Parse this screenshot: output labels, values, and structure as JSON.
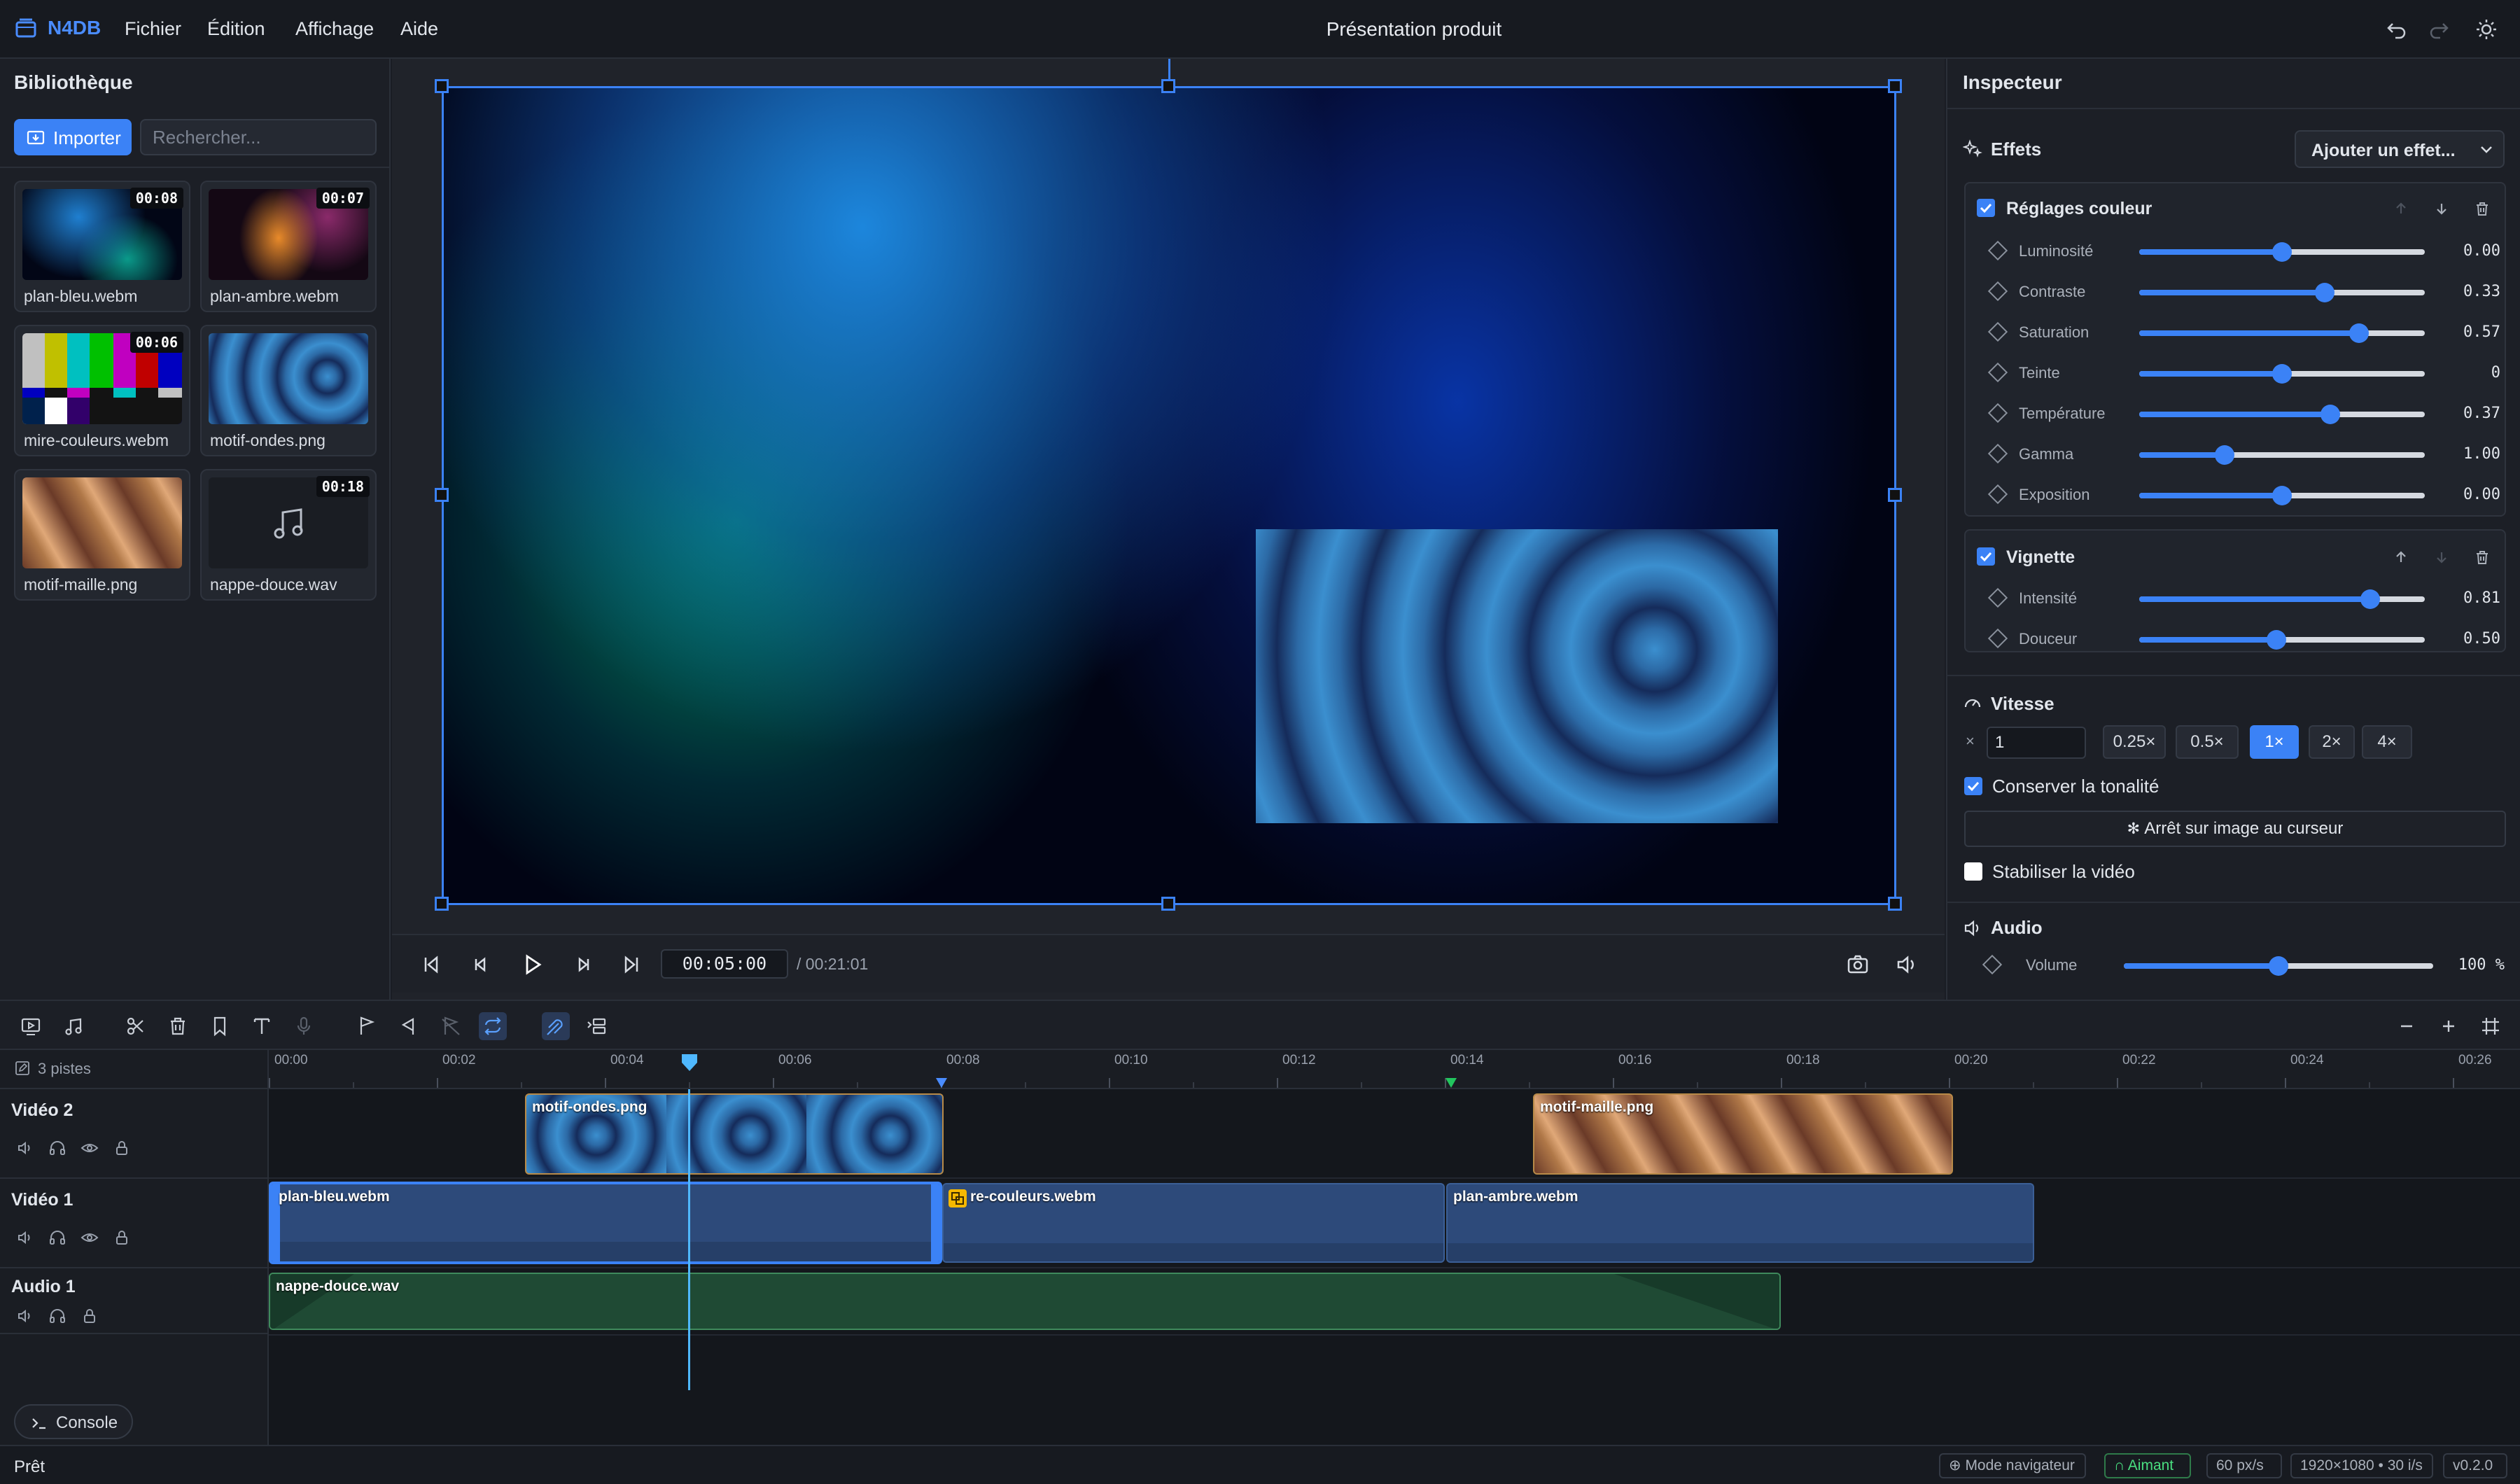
{
  "app": {
    "name": "N4DB",
    "title": "Présentation produit"
  },
  "menu": [
    "Fichier",
    "Édition",
    "Affichage",
    "Aide"
  ],
  "library": {
    "title": "Bibliothèque",
    "import_label": "Importer",
    "search_placeholder": "Rechercher...",
    "items": [
      {
        "name": "plan-bleu.webm",
        "duration": "00:08"
      },
      {
        "name": "plan-ambre.webm",
        "duration": "00:07"
      },
      {
        "name": "mire-couleurs.webm",
        "duration": "00:06"
      },
      {
        "name": "motif-ondes.png",
        "duration": ""
      },
      {
        "name": "motif-maille.png",
        "duration": ""
      },
      {
        "name": "nappe-douce.wav",
        "duration": "00:18"
      }
    ]
  },
  "transport": {
    "timecode": "00:05:00",
    "total": "/ 00:21:01"
  },
  "inspector": {
    "title": "Inspecteur",
    "effects_title": "Effets",
    "add_effect": "Ajouter un effet...",
    "color_effect": {
      "name": "Réglages couleur",
      "params": [
        {
          "label": "Luminosité",
          "value": "0.00",
          "level": 0.5
        },
        {
          "label": "Contraste",
          "value": "0.33",
          "level": 0.65
        },
        {
          "label": "Saturation",
          "value": "0.57",
          "level": 0.77
        },
        {
          "label": "Teinte",
          "value": "0",
          "level": 0.5
        },
        {
          "label": "Température",
          "value": "0.37",
          "level": 0.67
        },
        {
          "label": "Gamma",
          "value": "1.00",
          "level": 0.3
        },
        {
          "label": "Exposition",
          "value": "0.00",
          "level": 0.5
        }
      ]
    },
    "vignette_effect": {
      "name": "Vignette",
      "params": [
        {
          "label": "Intensité",
          "value": "0.81",
          "level": 0.81
        },
        {
          "label": "Douceur",
          "value": "0.50",
          "level": 0.48
        }
      ]
    },
    "speed": {
      "title": "Vitesse",
      "prefix": "×",
      "value": "1",
      "presets": [
        "0.25×",
        "0.5×",
        "1×",
        "2×",
        "4×"
      ],
      "active": "1×",
      "keep_pitch": "Conserver la tonalité",
      "freeze": "Arrêt sur image au curseur",
      "stabilize": "Stabiliser la vidéo"
    },
    "audio": {
      "title": "Audio",
      "volume_label": "Volume",
      "volume_value": "100 %",
      "level": 0.5
    }
  },
  "timeline": {
    "track_count": "3 pistes",
    "ticks": [
      "00:00",
      "00:02",
      "00:04",
      "00:06",
      "00:08",
      "00:10",
      "00:12",
      "00:14",
      "00:16",
      "00:18",
      "00:20",
      "00:22",
      "00:24",
      "00:26"
    ],
    "tracks": [
      "Vidéo 2",
      "Vidéo 1",
      "Audio 1"
    ],
    "clips": {
      "v2a": "motif-ondes.png",
      "v2b": "motif-maille.png",
      "v1a": "plan-bleu.webm",
      "v1b": "re-couleurs.webm",
      "v1c": "plan-ambre.webm",
      "a1": "nappe-douce.wav"
    },
    "console": "Console"
  },
  "status": {
    "text": "Prêt",
    "browser_mode": "Mode navigateur",
    "magnet": "Aimant",
    "zoom": "60 px/s",
    "format": "1920×1080 • 30 i/s",
    "version": "v0.2.0"
  },
  "colors": {
    "accent": "#3b82f6",
    "audio_clip": "#1f4a34",
    "video_clip": "#2d4a7a",
    "playhead": "#4fb8ff"
  }
}
